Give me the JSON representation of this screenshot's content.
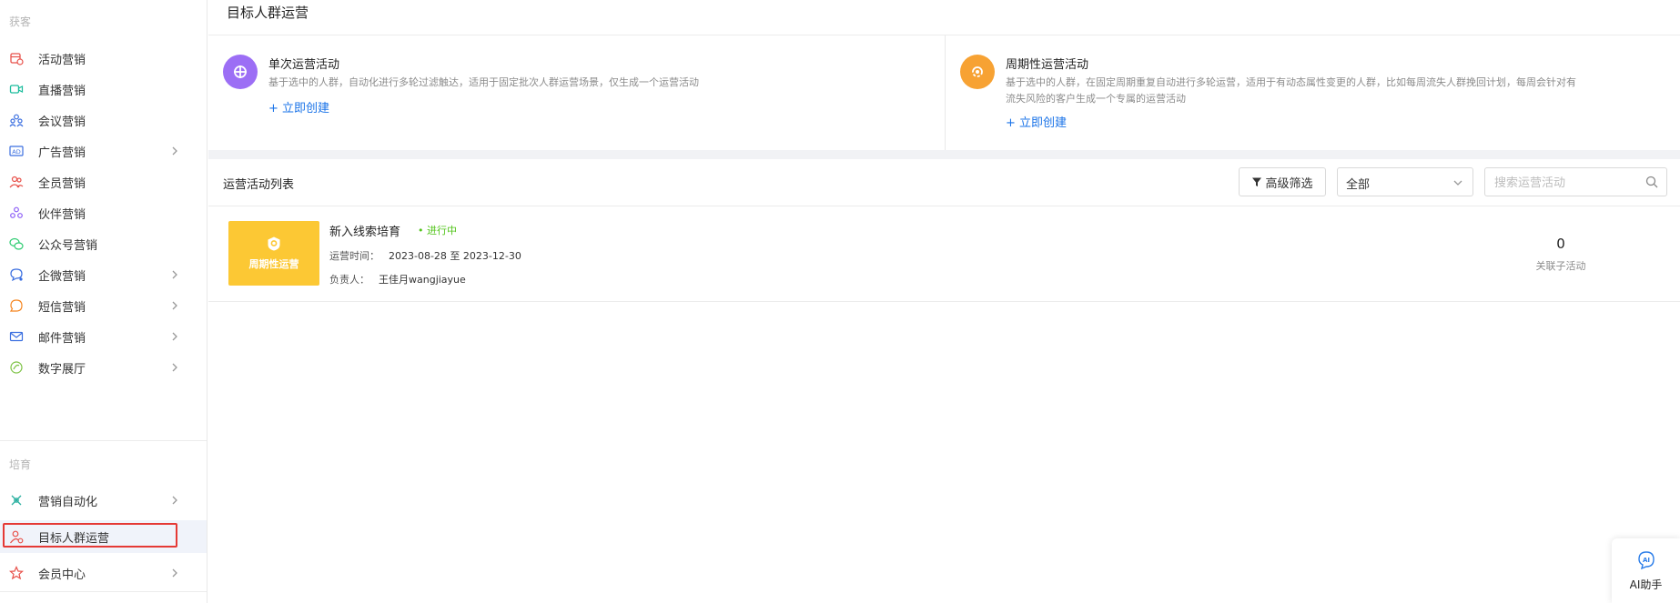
{
  "sidebar": {
    "groups": [
      "获客",
      "培育"
    ],
    "items": [
      {
        "label": "活动营销",
        "icon": "calendar-gift-icon"
      },
      {
        "label": "直播营销",
        "icon": "video-camera-icon"
      },
      {
        "label": "会议营销",
        "icon": "people-group-icon"
      },
      {
        "label": "广告营销",
        "icon": "ad-badge-icon"
      },
      {
        "label": "全员营销",
        "icon": "users-icon"
      },
      {
        "label": "伙伴营销",
        "icon": "partner-icon"
      },
      {
        "label": "公众号营销",
        "icon": "wechat-icon"
      },
      {
        "label": "企微营销",
        "icon": "chat-bubble-icon"
      },
      {
        "label": "短信营销",
        "icon": "sms-bubble-icon"
      },
      {
        "label": "邮件营销",
        "icon": "mail-icon"
      },
      {
        "label": "数字展厅",
        "icon": "digital-hall-icon"
      },
      {
        "label": "营销自动化",
        "icon": "automation-icon"
      },
      {
        "label": "目标人群运营",
        "icon": "target-user-icon"
      },
      {
        "label": "会员中心",
        "icon": "member-star-icon"
      }
    ]
  },
  "page": {
    "title": "目标人群运营"
  },
  "cards": [
    {
      "title": "单次运营活动",
      "desc": "基于选中的人群，自动化进行多轮过滤触达，适用于固定批次人群运营场景，仅生成一个运营活动",
      "link": "+ 立即创建",
      "color": "#9c6ef5"
    },
    {
      "title": "周期性运营活动",
      "desc_line1": "基于选中的人群，在固定周期重复自动进行多轮运营，适用于有动态属性变更的人群，比如每周流失人群挽回计划，每周会针对有",
      "desc_line2": "流失风险的客户生成一个专属的运营活动",
      "link": "+ 立即创建",
      "color": "#f7a233"
    }
  ],
  "list": {
    "title": "运营活动列表",
    "filter_button": "高级筛选",
    "select_value": "全部",
    "search_placeholder": "搜索运营活动",
    "rows": [
      {
        "thumb_label": "周期性运营",
        "name": "新入线索培育",
        "status": "• 进行中",
        "time_label": "运营时间：",
        "time_value": "2023-08-28 至 2023-12-30",
        "owner_label": "负责人：",
        "owner_value": "王佳月wangjiayue",
        "count": "0",
        "count_label": "关联子活动"
      }
    ]
  },
  "ai_assistant": {
    "label": "AI助手"
  }
}
